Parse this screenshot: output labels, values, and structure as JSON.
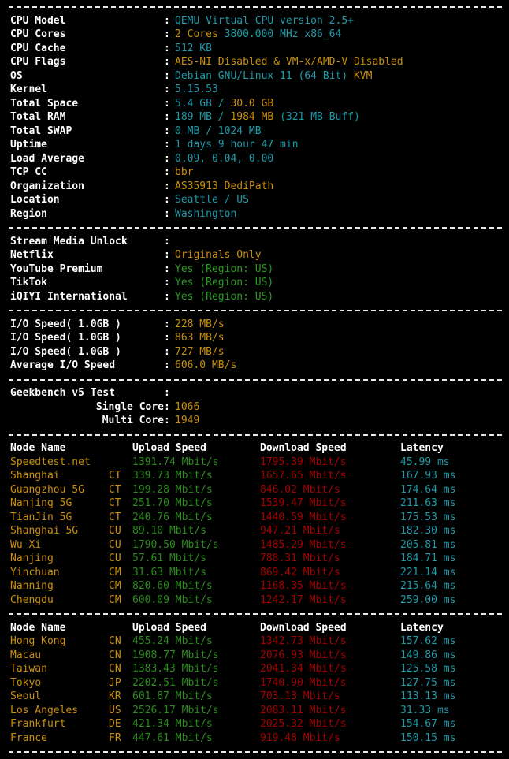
{
  "system_info": {
    "rows": [
      {
        "label": "CPU Model",
        "value": "QEMU Virtual CPU version 2.5+",
        "color": "cyan"
      },
      {
        "label": "CPU Cores",
        "value": "2 Cores 3800.000 MHz x86_64",
        "color": "split_gold_cyan",
        "gold_part": "2 Cores",
        "cyan_part": " 3800.000 MHz x86_64"
      },
      {
        "label": "CPU Cache",
        "value": "512 KB",
        "color": "cyan"
      },
      {
        "label": "CPU Flags",
        "value": "AES-NI Disabled & VM-x/AMD-V Disabled",
        "color": "gold"
      },
      {
        "label": "OS",
        "value": "Debian GNU/Linux 11 (64 Bit) KVM",
        "color": "split_cyan_gold",
        "cyan_part": "Debian GNU/Linux 11 (64 Bit) ",
        "gold_part": "KVM"
      },
      {
        "label": "Kernel",
        "value": "5.15.53",
        "color": "cyan"
      },
      {
        "label": "Total Space",
        "value": "5.4 GB / 30.0 GB",
        "color": "split_cyan_gold2",
        "cyan_part": "5.4 GB / ",
        "gold_part": "30.0 GB"
      },
      {
        "label": "Total RAM",
        "value": "189 MB / 1984 MB (321 MB Buff)",
        "color": "ram",
        "cyan_part": "189 MB / ",
        "gold_part": "1984 MB",
        "cyan_part2": " (321 MB Buff)"
      },
      {
        "label": "Total SWAP",
        "value": "0 MB / 1024 MB",
        "color": "cyan"
      },
      {
        "label": "Uptime",
        "value": "1 days 9 hour 47 min",
        "color": "cyan"
      },
      {
        "label": "Load Average",
        "value": "0.09, 0.04, 0.00",
        "color": "cyan"
      },
      {
        "label": "TCP CC",
        "value": "bbr",
        "color": "gold"
      },
      {
        "label": "Organization",
        "value": "AS35913 DediPath",
        "color": "gold"
      },
      {
        "label": "Location",
        "value": "Seattle / US",
        "color": "cyan"
      },
      {
        "label": "Region",
        "value": "Washington",
        "color": "cyan"
      }
    ]
  },
  "stream_media": {
    "title_label": "Stream Media Unlock",
    "title_value": "",
    "rows": [
      {
        "label": "Netflix",
        "value": "Originals Only",
        "color": "gold"
      },
      {
        "label": "YouTube Premium",
        "value": "Yes (Region: US)",
        "color": "green"
      },
      {
        "label": "TikTok",
        "value": "Yes (Region: US)",
        "color": "green"
      },
      {
        "label": "iQIYI International",
        "value": "Yes (Region: US)",
        "color": "green"
      }
    ]
  },
  "io_speed": {
    "rows": [
      {
        "label": "I/O Speed( 1.0GB )",
        "value": "228 MB/s",
        "color": "gold"
      },
      {
        "label": "I/O Speed( 1.0GB )",
        "value": "863 MB/s",
        "color": "gold"
      },
      {
        "label": "I/O Speed( 1.0GB )",
        "value": "727 MB/s",
        "color": "gold"
      },
      {
        "label": "Average I/O Speed",
        "value": "606.0 MB/s",
        "color": "gold"
      }
    ]
  },
  "geekbench": {
    "title_label": "Geekbench v5 Test",
    "title_value": "",
    "rows": [
      {
        "label": "Single Core",
        "value": "1066",
        "color": "gold"
      },
      {
        "label": "Multi Core",
        "value": "1949",
        "color": "gold"
      }
    ]
  },
  "speedtest_domestic": {
    "headers": {
      "node": "Node Name",
      "upload": "Upload Speed",
      "download": "Download Speed",
      "latency": "Latency"
    },
    "rows": [
      {
        "node": "Speedtest.net",
        "isp": "",
        "upload": "1391.74 Mbit/s",
        "download": "1795.39 Mbit/s",
        "latency": "45.99 ms"
      },
      {
        "node": "Shanghai",
        "isp": "CT",
        "upload": "339.73 Mbit/s",
        "download": "1657.65 Mbit/s",
        "latency": "167.93 ms"
      },
      {
        "node": "Guangzhou 5G",
        "isp": "CT",
        "upload": "199.28 Mbit/s",
        "download": "846.02 Mbit/s",
        "latency": "174.64 ms"
      },
      {
        "node": "Nanjing 5G",
        "isp": "CT",
        "upload": "251.70 Mbit/s",
        "download": "1539.47 Mbit/s",
        "latency": "211.63 ms"
      },
      {
        "node": "TianJin 5G",
        "isp": "CT",
        "upload": "240.76 Mbit/s",
        "download": "1440.59 Mbit/s",
        "latency": "175.53 ms"
      },
      {
        "node": "Shanghai 5G",
        "isp": "CU",
        "upload": "89.10 Mbit/s",
        "download": "947.21 Mbit/s",
        "latency": "182.30 ms"
      },
      {
        "node": "Wu Xi",
        "isp": "CU",
        "upload": "1790.50 Mbit/s",
        "download": "1485.29 Mbit/s",
        "latency": "205.81 ms"
      },
      {
        "node": "Nanjing",
        "isp": "CU",
        "upload": "57.61 Mbit/s",
        "download": "788.31 Mbit/s",
        "latency": "184.71 ms"
      },
      {
        "node": "Yinchuan",
        "isp": "CM",
        "upload": "31.63 Mbit/s",
        "download": "869.42 Mbit/s",
        "latency": "221.14 ms"
      },
      {
        "node": "Nanning",
        "isp": "CM",
        "upload": "820.60 Mbit/s",
        "download": "1168.35 Mbit/s",
        "latency": "215.64 ms"
      },
      {
        "node": "Chengdu",
        "isp": "CM",
        "upload": "600.09 Mbit/s",
        "download": "1242.17 Mbit/s",
        "latency": "259.00 ms"
      }
    ]
  },
  "speedtest_international": {
    "headers": {
      "node": "Node Name",
      "upload": "Upload Speed",
      "download": "Download Speed",
      "latency": "Latency"
    },
    "rows": [
      {
        "node": "Hong Kong",
        "isp": "CN",
        "upload": "455.24 Mbit/s",
        "download": "1342.73 Mbit/s",
        "latency": "157.62 ms"
      },
      {
        "node": "Macau",
        "isp": "CN",
        "upload": "1908.77 Mbit/s",
        "download": "2076.93 Mbit/s",
        "latency": "149.86 ms"
      },
      {
        "node": "Taiwan",
        "isp": "CN",
        "upload": "1383.43 Mbit/s",
        "download": "2041.34 Mbit/s",
        "latency": "125.58 ms"
      },
      {
        "node": "Tokyo",
        "isp": "JP",
        "upload": "2202.51 Mbit/s",
        "download": "1740.90 Mbit/s",
        "latency": "127.75 ms"
      },
      {
        "node": "Seoul",
        "isp": "KR",
        "upload": "601.87 Mbit/s",
        "download": "703.13 Mbit/s",
        "latency": "113.13 ms"
      },
      {
        "node": "Los Angeles",
        "isp": "US",
        "upload": "2526.17 Mbit/s",
        "download": "2083.11 Mbit/s",
        "latency": "31.33 ms"
      },
      {
        "node": "Frankfurt",
        "isp": "DE",
        "upload": "421.34 Mbit/s",
        "download": "2025.32 Mbit/s",
        "latency": "154.67 ms"
      },
      {
        "node": "France",
        "isp": "FR",
        "upload": "447.61 Mbit/s",
        "download": "919.48 Mbit/s",
        "latency": "150.15 ms"
      }
    ]
  },
  "colors": {
    "background": "#000000",
    "label": "#ffffff",
    "cyan": "#1e9aa8",
    "gold": "#c98f0a",
    "green": "#2a9a22",
    "upload_green": "#2a8c1b",
    "download_red": "#a50000",
    "latency_teal": "#1e9aa8",
    "separator": "#e8e8e8"
  }
}
